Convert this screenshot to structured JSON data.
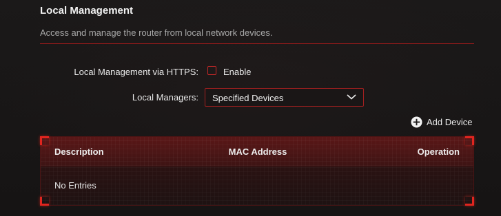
{
  "section": {
    "title": "Local Management",
    "subtitle": "Access and manage the router from local network devices."
  },
  "https": {
    "label": "Local Management via HTTPS:",
    "checkbox_label": "Enable",
    "checked": false
  },
  "managers": {
    "label": "Local Managers:",
    "selected": "Specified Devices"
  },
  "add_device": {
    "label": "Add Device",
    "icon": "plus-circle-icon"
  },
  "table": {
    "columns": [
      "Description",
      "MAC Address",
      "Operation"
    ],
    "empty_text": "No Entries"
  },
  "colors": {
    "accent": "#c62828",
    "background": "#1a1717"
  }
}
